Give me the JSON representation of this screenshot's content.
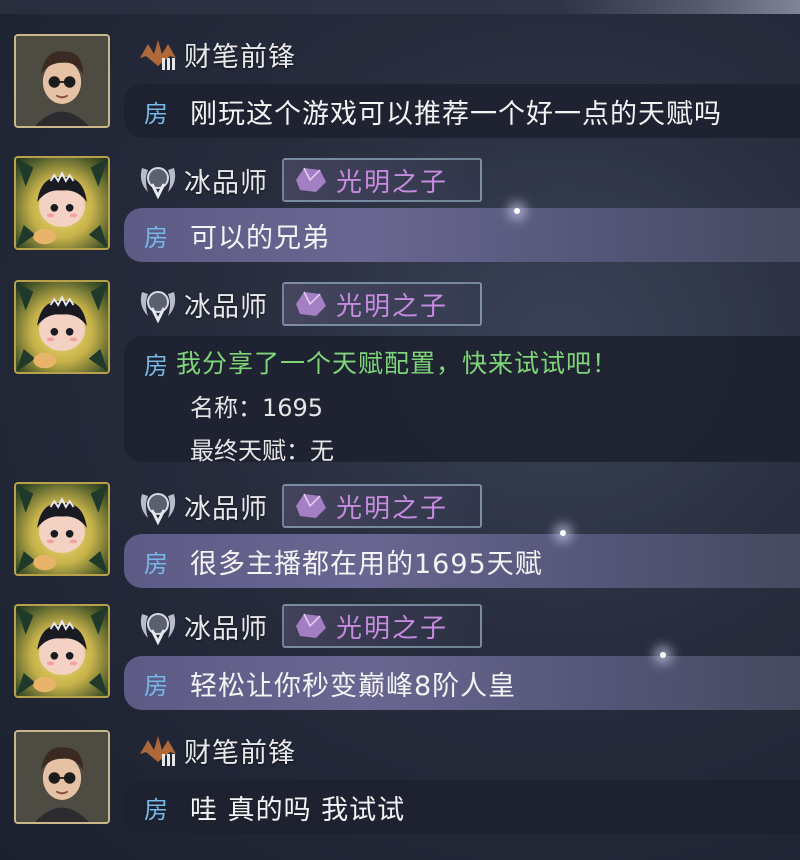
{
  "room_tag": "房",
  "messages": [
    {
      "sender": "财笔前锋",
      "avatar_icon": "male-character-avatar",
      "rank_icon": "bronze-rank-icon",
      "text": "刚玩这个游戏可以推荐一个好一点的天赋吗"
    },
    {
      "sender": "冰品师",
      "avatar_icon": "female-character-avatar",
      "rank_icon": "silver-rank-v-icon",
      "title_badge": "光明之子",
      "text": "可以的兄弟"
    },
    {
      "sender": "冰品师",
      "avatar_icon": "female-character-avatar",
      "rank_icon": "silver-rank-v-icon",
      "title_badge": "光明之子",
      "share": {
        "headline": "我分享了一个天赋配置，快来试试吧！",
        "name_label": "名称：",
        "name_value": "1695",
        "final_label": "最终天赋：",
        "final_value": "无"
      }
    },
    {
      "sender": "冰品师",
      "avatar_icon": "female-character-avatar",
      "rank_icon": "silver-rank-v-icon",
      "title_badge": "光明之子",
      "text": "很多主播都在用的1695天赋"
    },
    {
      "sender": "冰品师",
      "avatar_icon": "female-character-avatar",
      "rank_icon": "silver-rank-v-icon",
      "title_badge": "光明之子",
      "text": "轻松让你秒变巅峰8阶人皇"
    },
    {
      "sender": "财笔前锋",
      "avatar_icon": "male-character-avatar",
      "rank_icon": "bronze-rank-icon",
      "text": "哇 真的吗 我试试"
    }
  ],
  "colors": {
    "room_tag": "#76b8e8",
    "share_headline": "#7fd67a",
    "title_badge_text": "#c78be0",
    "purple_bubble": "#6a6692",
    "dark_bubble": "#1e2230"
  }
}
